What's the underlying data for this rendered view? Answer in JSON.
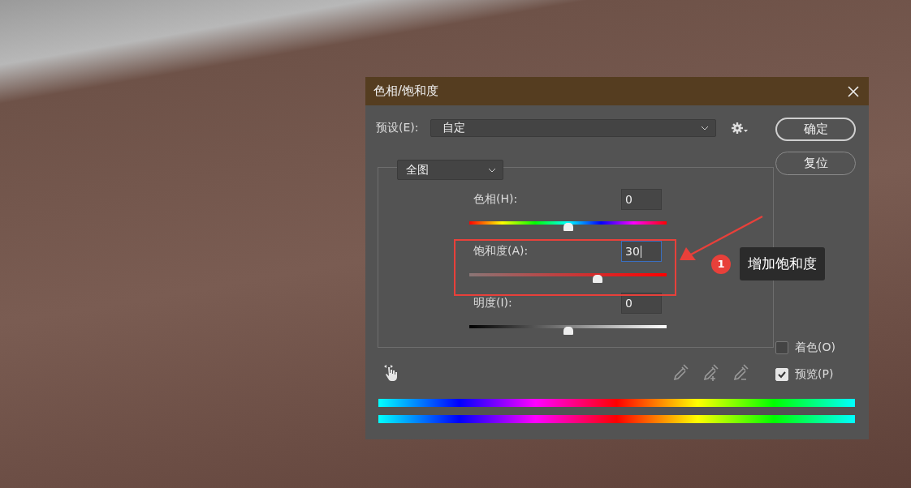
{
  "dialog": {
    "title": "色相/饱和度",
    "preset": {
      "label": "预设(E):",
      "value": "自定"
    },
    "channel": "全图",
    "sliders": [
      {
        "kind": "hue",
        "label": "色相(H):",
        "value": "0",
        "level": 0.5,
        "focused": false
      },
      {
        "kind": "saturation",
        "label": "饱和度(A):",
        "value": "30",
        "level": 0.65,
        "focused": true
      },
      {
        "kind": "lightness",
        "label": "明度(I):",
        "value": "0",
        "level": 0.5,
        "focused": false
      }
    ],
    "buttons": [
      {
        "label": "确定",
        "default": true
      },
      {
        "label": "复位",
        "default": false
      }
    ],
    "checkboxes": [
      {
        "label": "着色(O)",
        "checked": false
      },
      {
        "label": "预览(P)",
        "checked": true
      }
    ]
  },
  "annotation": {
    "badge": "1",
    "text": "增加饱和度"
  }
}
